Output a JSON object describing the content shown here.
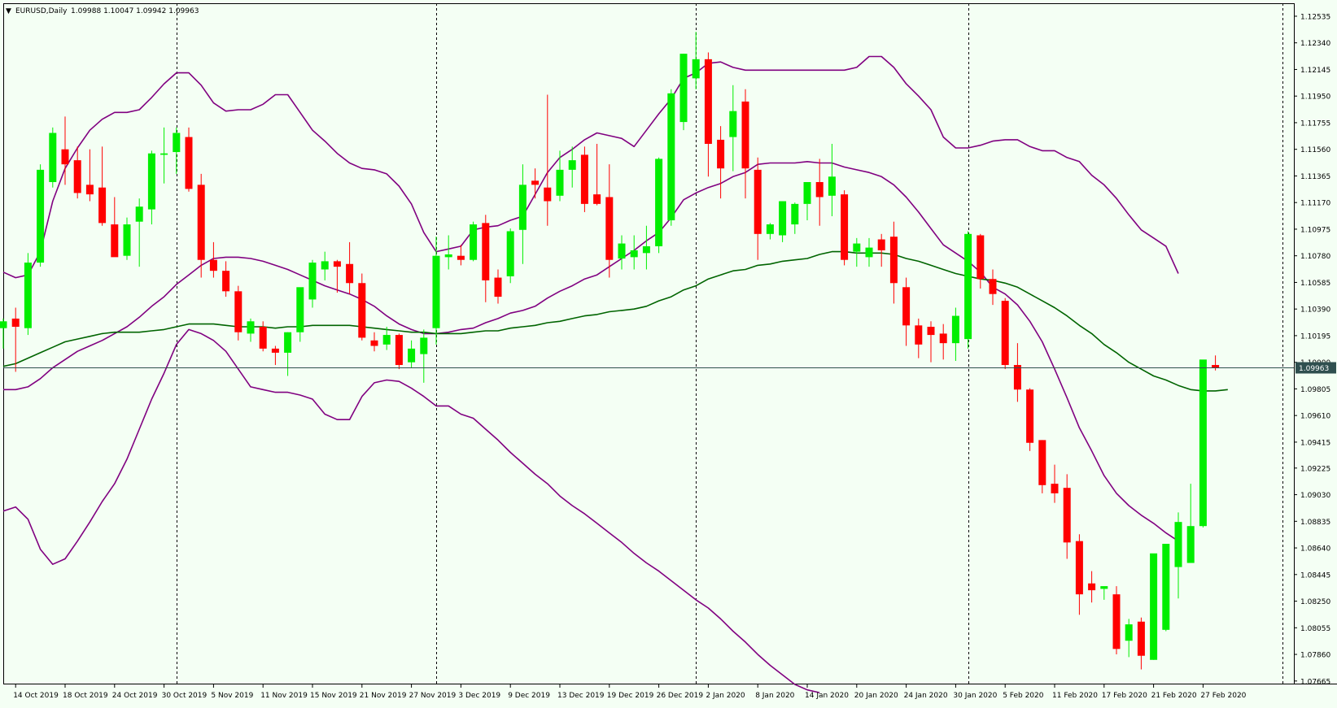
{
  "header": {
    "arrow": "▼",
    "symbol": "EURUSD,Daily",
    "ohlc": "1.09988 1.10047 1.09942 1.09963"
  },
  "price_tag": "1.09963",
  "colors": {
    "background": "#F4FFF4",
    "bull": "#00EE00",
    "bear": "#FF0000",
    "bands": "#800080",
    "ma": "#006400",
    "price_line": "#2F4F4F",
    "tag_bg": "#2F4F4F",
    "tag_text": "#FFFFFF"
  },
  "chart_data": {
    "type": "candlestick",
    "title": "EURUSD,Daily",
    "ylim": [
      1.0764,
      1.1263
    ],
    "y_ticks": [
      "1.12535",
      "1.12340",
      "1.12145",
      "1.11950",
      "1.11755",
      "1.11560",
      "1.11365",
      "1.11170",
      "1.10975",
      "1.10780",
      "1.10585",
      "1.10390",
      "1.10195",
      "1.10000",
      "1.09805",
      "1.09610",
      "1.09415",
      "1.09225",
      "1.09030",
      "1.08835",
      "1.08640",
      "1.08445",
      "1.08250",
      "1.08055",
      "1.07860",
      "1.07665"
    ],
    "x_ticks": [
      {
        "label": "14 Oct 2019",
        "i": 1
      },
      {
        "label": "18 Oct 2019",
        "i": 5
      },
      {
        "label": "24 Oct 2019",
        "i": 9
      },
      {
        "label": "30 Oct 2019",
        "i": 13
      },
      {
        "label": "5 Nov 2019",
        "i": 17
      },
      {
        "label": "11 Nov 2019",
        "i": 21
      },
      {
        "label": "15 Nov 2019",
        "i": 25
      },
      {
        "label": "21 Nov 2019",
        "i": 29
      },
      {
        "label": "27 Nov 2019",
        "i": 33
      },
      {
        "label": "3 Dec 2019",
        "i": 37
      },
      {
        "label": "9 Dec 2019",
        "i": 41
      },
      {
        "label": "13 Dec 2019",
        "i": 45
      },
      {
        "label": "19 Dec 2019",
        "i": 49
      },
      {
        "label": "26 Dec 2019",
        "i": 53
      },
      {
        "label": "2 Jan 2020",
        "i": 57
      },
      {
        "label": "8 Jan 2020",
        "i": 61
      },
      {
        "label": "14 Jan 2020",
        "i": 65
      },
      {
        "label": "20 Jan 2020",
        "i": 69
      },
      {
        "label": "24 Jan 2020",
        "i": 73
      },
      {
        "label": "30 Jan 2020",
        "i": 77
      },
      {
        "label": "5 Feb 2020",
        "i": 81
      },
      {
        "label": "11 Feb 2020",
        "i": 85
      },
      {
        "label": "17 Feb 2020",
        "i": 89
      },
      {
        "label": "21 Feb 2020",
        "i": 93
      },
      {
        "label": "27 Feb 2020",
        "i": 97
      }
    ],
    "separators": [
      14,
      35,
      56,
      78
    ],
    "last_price": 1.09963,
    "candles": [
      [
        1.1025,
        1.1032,
        1.101,
        1.103
      ],
      [
        1.1032,
        1.104,
        1.0993,
        1.1026
      ],
      [
        1.1025,
        1.108,
        1.102,
        1.1073
      ],
      [
        1.1073,
        1.1145,
        1.107,
        1.1141
      ],
      [
        1.1132,
        1.1172,
        1.1128,
        1.1168
      ],
      [
        1.1156,
        1.118,
        1.113,
        1.1145
      ],
      [
        1.1148,
        1.1158,
        1.112,
        1.1124
      ],
      [
        1.113,
        1.1156,
        1.1118,
        1.1123
      ],
      [
        1.1128,
        1.1158,
        1.11,
        1.1102
      ],
      [
        1.1101,
        1.1121,
        1.108,
        1.1077
      ],
      [
        1.1078,
        1.1106,
        1.1075,
        1.1101
      ],
      [
        1.1103,
        1.112,
        1.107,
        1.1114
      ],
      [
        1.1112,
        1.1155,
        1.1101,
        1.1153
      ],
      [
        1.1152,
        1.1172,
        1.1131,
        1.1153
      ],
      [
        1.1154,
        1.1172,
        1.1138,
        1.1168
      ],
      [
        1.1165,
        1.1172,
        1.1125,
        1.1127
      ],
      [
        1.113,
        1.1138,
        1.1062,
        1.1075
      ],
      [
        1.1075,
        1.1088,
        1.1062,
        1.1067
      ],
      [
        1.1067,
        1.1074,
        1.1048,
        1.1052
      ],
      [
        1.1052,
        1.1056,
        1.1016,
        1.1022
      ],
      [
        1.1021,
        1.1032,
        1.1015,
        1.103
      ],
      [
        1.1026,
        1.103,
        1.1008,
        1.101
      ],
      [
        1.101,
        1.1012,
        1.0998,
        1.1007
      ],
      [
        1.1007,
        1.1022,
        1.099,
        1.1022
      ],
      [
        1.1022,
        1.1047,
        1.1015,
        1.1055
      ],
      [
        1.1046,
        1.1075,
        1.104,
        1.1073
      ],
      [
        1.1068,
        1.1081,
        1.106,
        1.1074
      ],
      [
        1.1074,
        1.1075,
        1.1051,
        1.107
      ],
      [
        1.1072,
        1.1088,
        1.105,
        1.1058
      ],
      [
        1.1058,
        1.1065,
        1.1016,
        1.1018
      ],
      [
        1.1016,
        1.1022,
        1.1008,
        1.1012
      ],
      [
        1.1013,
        1.1026,
        1.1009,
        1.102
      ],
      [
        1.102,
        1.1021,
        1.0995,
        1.0998
      ],
      [
        1.1,
        1.1016,
        1.0996,
        1.101
      ],
      [
        1.1006,
        1.1024,
        1.0985,
        1.1018
      ],
      [
        1.1025,
        1.1092,
        1.1013,
        1.1078
      ],
      [
        1.1077,
        1.1093,
        1.1068,
        1.1079
      ],
      [
        1.1078,
        1.1086,
        1.1071,
        1.1075
      ],
      [
        1.1075,
        1.1103,
        1.1074,
        1.1101
      ],
      [
        1.1102,
        1.1108,
        1.1044,
        1.106
      ],
      [
        1.1062,
        1.1068,
        1.1043,
        1.1048
      ],
      [
        1.1063,
        1.1098,
        1.1058,
        1.1096
      ],
      [
        1.1097,
        1.1145,
        1.1072,
        1.113
      ],
      [
        1.1133,
        1.1142,
        1.112,
        1.113
      ],
      [
        1.1128,
        1.1196,
        1.11,
        1.1118
      ],
      [
        1.1122,
        1.1155,
        1.1118,
        1.1141
      ],
      [
        1.1141,
        1.1158,
        1.1128,
        1.1148
      ],
      [
        1.1152,
        1.1158,
        1.111,
        1.1116
      ],
      [
        1.1123,
        1.116,
        1.1115,
        1.1116
      ],
      [
        1.1121,
        1.1145,
        1.1062,
        1.1075
      ],
      [
        1.1076,
        1.1093,
        1.1068,
        1.1087
      ],
      [
        1.1077,
        1.1093,
        1.1068,
        1.1082
      ],
      [
        1.108,
        1.11,
        1.1068,
        1.1085
      ],
      [
        1.1085,
        1.115,
        1.108,
        1.1149
      ],
      [
        1.1104,
        1.12,
        1.11,
        1.1197
      ],
      [
        1.1176,
        1.1226,
        1.117,
        1.1226
      ],
      [
        1.1208,
        1.1242,
        1.12,
        1.1222
      ],
      [
        1.1222,
        1.1227,
        1.1136,
        1.116
      ],
      [
        1.1163,
        1.1173,
        1.112,
        1.1142
      ],
      [
        1.1165,
        1.1203,
        1.114,
        1.1184
      ],
      [
        1.1191,
        1.12,
        1.112,
        1.1142
      ],
      [
        1.1141,
        1.115,
        1.1075,
        1.1094
      ],
      [
        1.1094,
        1.1102,
        1.109,
        1.1101
      ],
      [
        1.1093,
        1.1118,
        1.1088,
        1.1118
      ],
      [
        1.1101,
        1.1117,
        1.1094,
        1.1116
      ],
      [
        1.1116,
        1.1116,
        1.1104,
        1.1132
      ],
      [
        1.1132,
        1.1149,
        1.11,
        1.1121
      ],
      [
        1.1122,
        1.116,
        1.1107,
        1.1136
      ],
      [
        1.1123,
        1.1126,
        1.1071,
        1.1075
      ],
      [
        1.1081,
        1.1091,
        1.107,
        1.1087
      ],
      [
        1.1077,
        1.1091,
        1.107,
        1.1084
      ],
      [
        1.109,
        1.1094,
        1.107,
        1.1082
      ],
      [
        1.1092,
        1.1103,
        1.1043,
        1.1058
      ],
      [
        1.1055,
        1.1062,
        1.1012,
        1.1027
      ],
      [
        1.1027,
        1.1032,
        1.1003,
        1.1013
      ],
      [
        1.1026,
        1.103,
        1.1,
        1.102
      ],
      [
        1.1021,
        1.1028,
        1.1002,
        1.1014
      ],
      [
        1.1014,
        1.104,
        1.1001,
        1.1034
      ],
      [
        1.1017,
        1.1096,
        1.101,
        1.1094
      ],
      [
        1.1093,
        1.1094,
        1.1054,
        1.1061
      ],
      [
        1.1061,
        1.1068,
        1.1042,
        1.105
      ],
      [
        1.1045,
        1.1047,
        1.0995,
        1.0998
      ],
      [
        1.0998,
        1.1014,
        1.0971,
        1.098
      ],
      [
        1.098,
        1.0981,
        1.0935,
        1.0941
      ],
      [
        1.0943,
        1.0943,
        1.0904,
        1.091
      ],
      [
        1.0911,
        1.0925,
        1.0897,
        1.0904
      ],
      [
        1.0908,
        1.0918,
        1.0856,
        1.0868
      ],
      [
        1.0869,
        1.0874,
        1.0815,
        1.083
      ],
      [
        1.0838,
        1.0847,
        1.0824,
        1.0833
      ],
      [
        1.0834,
        1.0835,
        1.0826,
        1.0836
      ],
      [
        1.083,
        1.0836,
        1.0786,
        1.079
      ],
      [
        1.0796,
        1.0812,
        1.0784,
        1.0808
      ],
      [
        1.081,
        1.0813,
        1.0775,
        1.0785
      ],
      [
        1.0782,
        1.0859,
        1.0782,
        1.086
      ],
      [
        1.0804,
        1.0866,
        1.0803,
        1.0867
      ],
      [
        1.085,
        1.089,
        1.0827,
        1.0883
      ],
      [
        1.0853,
        1.0911,
        1.0853,
        1.088
      ],
      [
        1.088,
        1.0983,
        1.0879,
        1.1002
      ],
      [
        1.0998,
        1.1005,
        1.0994,
        1.0996
      ]
    ],
    "series": [
      {
        "name": "ma",
        "values": [
          1.0997,
          1.0999,
          1.1003,
          1.1007,
          1.1011,
          1.1015,
          1.1017,
          1.1019,
          1.1021,
          1.1022,
          1.1022,
          1.1022,
          1.1023,
          1.1024,
          1.1026,
          1.1028,
          1.1028,
          1.1028,
          1.1027,
          1.1026,
          1.1026,
          1.1026,
          1.1025,
          1.1026,
          1.1026,
          1.1027,
          1.1027,
          1.1027,
          1.1027,
          1.1026,
          1.1025,
          1.1024,
          1.1023,
          1.1022,
          1.1022,
          1.1021,
          1.1021,
          1.1021,
          1.1022,
          1.1023,
          1.1023,
          1.1025,
          1.1026,
          1.1027,
          1.1029,
          1.103,
          1.1032,
          1.1034,
          1.1035,
          1.1037,
          1.1038,
          1.1039,
          1.1041,
          1.1045,
          1.1048,
          1.1053,
          1.1056,
          1.1061,
          1.1064,
          1.1067,
          1.1068,
          1.1071,
          1.1072,
          1.1074,
          1.1075,
          1.1076,
          1.1079,
          1.1081,
          1.1081,
          1.108,
          1.108,
          1.108,
          1.1079,
          1.1076,
          1.1074,
          1.1071,
          1.1068,
          1.1065,
          1.1063,
          1.1061,
          1.106,
          1.1058,
          1.1055,
          1.105,
          1.1045,
          1.104,
          1.1034,
          1.1027,
          1.1021,
          1.1013,
          1.1007,
          1.1,
          1.0995,
          1.099,
          1.0987,
          1.0983,
          1.098,
          1.0979,
          1.0979,
          1.098
        ]
      },
      {
        "name": "band-1",
        "values": [
          1.1066,
          1.1062,
          1.1064,
          1.1081,
          1.1118,
          1.1142,
          1.1157,
          1.117,
          1.1178,
          1.1183,
          1.1183,
          1.1185,
          1.1194,
          1.1204,
          1.1212,
          1.1212,
          1.1203,
          1.119,
          1.1184,
          1.1185,
          1.1185,
          1.1189,
          1.1196,
          1.1196,
          1.1183,
          1.117,
          1.1162,
          1.1153,
          1.1146,
          1.1142,
          1.1141,
          1.1138,
          1.1129,
          1.1116,
          1.1095,
          1.1081,
          1.1083,
          1.1085,
          1.1097,
          1.1099,
          1.11,
          1.1104,
          1.1107,
          1.1123,
          1.1139,
          1.115,
          1.1156,
          1.1163,
          1.1168,
          1.1166,
          1.1164,
          1.1158,
          1.117,
          1.1182,
          1.1193,
          1.1208,
          1.1212,
          1.1219,
          1.122,
          1.1216,
          1.1214,
          1.1214,
          1.1214,
          1.1214,
          1.1214,
          1.1214,
          1.1214,
          1.1214,
          1.1214,
          1.1216,
          1.1224,
          1.1224,
          1.1216,
          1.1204,
          1.1195,
          1.1185,
          1.1165,
          1.1157,
          1.1157,
          1.1159,
          1.1162,
          1.1163,
          1.1163,
          1.1158,
          1.1155,
          1.1155,
          1.115,
          1.1147,
          1.1137,
          1.113,
          1.112,
          1.1108,
          1.1097,
          1.1091,
          1.1085,
          1.1065
        ]
      },
      {
        "name": "band-2",
        "values": [
          1.098,
          1.098,
          1.0982,
          1.0988,
          1.0996,
          1.1002,
          1.1008,
          1.1012,
          1.1016,
          1.1021,
          1.1026,
          1.1033,
          1.1041,
          1.1048,
          1.1057,
          1.1064,
          1.1071,
          1.1076,
          1.1077,
          1.1077,
          1.1076,
          1.1074,
          1.1071,
          1.1068,
          1.1064,
          1.106,
          1.1056,
          1.1053,
          1.105,
          1.1046,
          1.1041,
          1.1034,
          1.1028,
          1.1024,
          1.1021,
          1.1021,
          1.1022,
          1.1024,
          1.1025,
          1.1029,
          1.1032,
          1.1036,
          1.1038,
          1.1041,
          1.1047,
          1.1052,
          1.1056,
          1.1061,
          1.1064,
          1.107,
          1.1076,
          1.1082,
          1.1089,
          1.1095,
          1.1106,
          1.1119,
          1.1124,
          1.1128,
          1.1131,
          1.1136,
          1.1139,
          1.1145,
          1.1146,
          1.1146,
          1.1146,
          1.1147,
          1.1146,
          1.1146,
          1.1143,
          1.1141,
          1.1139,
          1.1136,
          1.113,
          1.1121,
          1.111,
          1.1098,
          1.1086,
          1.108,
          1.1074,
          1.1066,
          1.1055,
          1.105,
          1.1042,
          1.103,
          1.1015,
          1.0995,
          1.0974,
          1.0952,
          1.0935,
          1.0917,
          1.0904,
          1.0895,
          1.0888,
          1.0882,
          1.0875,
          1.0869
        ]
      },
      {
        "name": "band-3",
        "values": [
          1.0891,
          1.0894,
          1.0885,
          1.0863,
          1.0852,
          1.0856,
          1.0869,
          1.0883,
          1.0898,
          1.0911,
          1.0929,
          1.0951,
          1.0973,
          1.0992,
          1.1013,
          1.1024,
          1.1021,
          1.1016,
          1.1008,
          1.0995,
          1.0982,
          1.098,
          1.0978,
          1.0978,
          1.0976,
          1.0973,
          1.0962,
          1.0958,
          1.0958,
          1.0975,
          1.0985,
          1.0987,
          1.0986,
          1.0981,
          1.0975,
          1.0968,
          1.0968,
          1.0962,
          1.0959,
          1.0951,
          1.0943,
          1.0934,
          1.0926,
          1.0918,
          1.0911,
          1.0902,
          1.0895,
          1.0889,
          1.0882,
          1.0875,
          1.0868,
          1.086,
          1.0853,
          1.0847,
          1.084,
          1.0833,
          1.0826,
          1.082,
          1.0812,
          1.0803,
          1.0795,
          1.0786,
          1.0778,
          1.0771,
          1.0764,
          1.076,
          1.0758
        ]
      }
    ]
  }
}
